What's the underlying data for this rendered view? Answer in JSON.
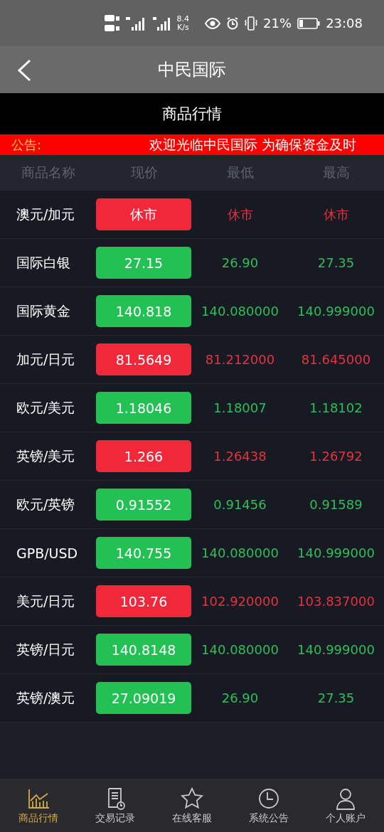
{
  "status_bar": {
    "speed": "8.4",
    "speed_unit": "K/s",
    "battery": "21%",
    "time": "23:08"
  },
  "header": {
    "title": "中民国际"
  },
  "section_title": "商品行情",
  "notice": {
    "label": "公告:",
    "text": "欢迎光临中民国际 为确保资金及时"
  },
  "columns": [
    "商品名称",
    "现价",
    "最低",
    "最高"
  ],
  "rows": [
    {
      "name": "澳元/加元",
      "price": "休市",
      "low": "休市",
      "high": "休市",
      "kind": "fall"
    },
    {
      "name": "国际白银",
      "price": "27.15",
      "low": "26.90",
      "high": "27.35",
      "kind": "rise"
    },
    {
      "name": "国际黄金",
      "price": "140.818",
      "low": "140.080000",
      "high": "140.999000",
      "kind": "rise"
    },
    {
      "name": "加元/日元",
      "price": "81.5649",
      "low": "81.212000",
      "high": "81.645000",
      "kind": "fall"
    },
    {
      "name": "欧元/美元",
      "price": "1.18046",
      "low": "1.18007",
      "high": "1.18102",
      "kind": "rise"
    },
    {
      "name": "英镑/美元",
      "price": "1.266",
      "low": "1.26438",
      "high": "1.26792",
      "kind": "fall"
    },
    {
      "name": "欧元/英镑",
      "price": "0.91552",
      "low": "0.91456",
      "high": "0.91589",
      "kind": "rise"
    },
    {
      "name": "GPB/USD",
      "price": "140.755",
      "low": "140.080000",
      "high": "140.999000",
      "kind": "rise"
    },
    {
      "name": "美元/日元",
      "price": "103.76",
      "low": "102.920000",
      "high": "103.837000",
      "kind": "fall"
    },
    {
      "name": "英镑/日元",
      "price": "140.8148",
      "low": "140.080000",
      "high": "140.999000",
      "kind": "rise"
    },
    {
      "name": "英镑/澳元",
      "price": "27.09019",
      "low": "26.90",
      "high": "27.35",
      "kind": "rise"
    }
  ],
  "tabs": [
    {
      "label": "商品行情",
      "kind": "chart",
      "selected": true
    },
    {
      "label": "交易记录",
      "kind": "record",
      "selected": false
    },
    {
      "label": "在线客服",
      "kind": "star",
      "selected": false
    },
    {
      "label": "系统公告",
      "kind": "clock",
      "selected": false
    },
    {
      "label": "个人账户",
      "kind": "person",
      "selected": false
    }
  ]
}
